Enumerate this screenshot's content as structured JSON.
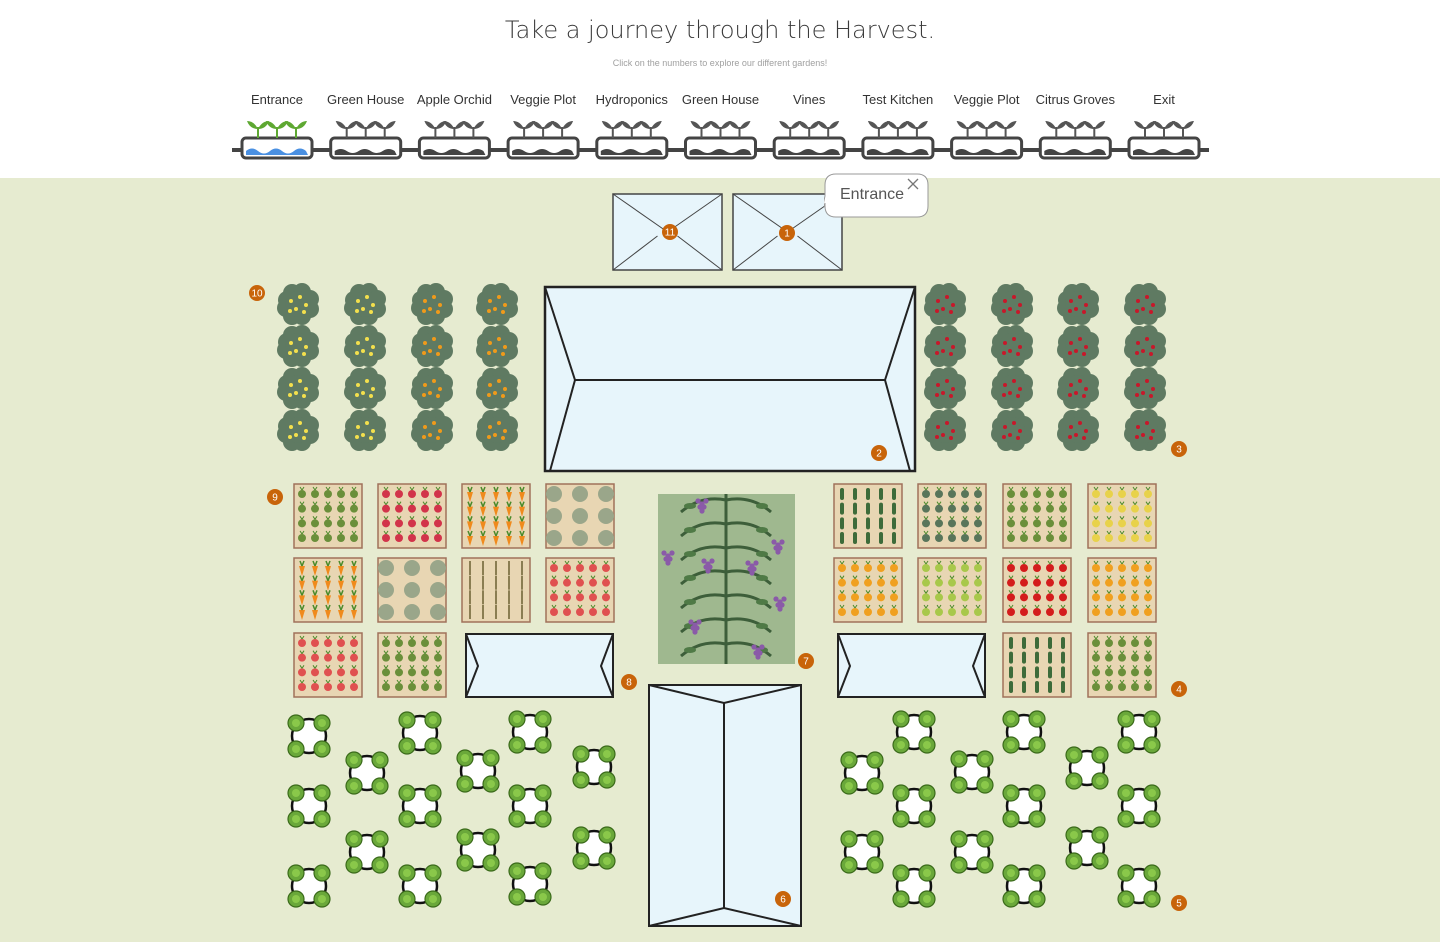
{
  "header": {
    "title": "Take a journey through the Harvest.",
    "subtitle": "Click on the numbers to explore our different gardens!"
  },
  "timeline": {
    "stops": [
      {
        "label": "Entrance",
        "active": true
      },
      {
        "label": "Green House",
        "active": false
      },
      {
        "label": "Apple Orchid",
        "active": false
      },
      {
        "label": "Veggie Plot",
        "active": false
      },
      {
        "label": "Hydroponics",
        "active": false
      },
      {
        "label": "Green House",
        "active": false
      },
      {
        "label": "Vines",
        "active": false
      },
      {
        "label": "Test Kitchen",
        "active": false
      },
      {
        "label": "Veggie Plot",
        "active": false
      },
      {
        "label": "Citrus Groves",
        "active": false
      },
      {
        "label": "Exit",
        "active": false
      }
    ]
  },
  "markers": [
    "1",
    "2",
    "3",
    "4",
    "5",
    "6",
    "7",
    "8",
    "9",
    "10",
    "11"
  ],
  "tooltip": {
    "label": "Entrance"
  },
  "colors": {
    "ground": "#e6ebd0",
    "marker": "#c8640a",
    "greenhouse": "#e7f5fb",
    "tree": "#5f7a62",
    "lemon": "#f4e04d",
    "orange": "#f09a1a",
    "apple": "#c8182a",
    "water": "#4a90e2",
    "vine_bg": "#9fb88f"
  }
}
